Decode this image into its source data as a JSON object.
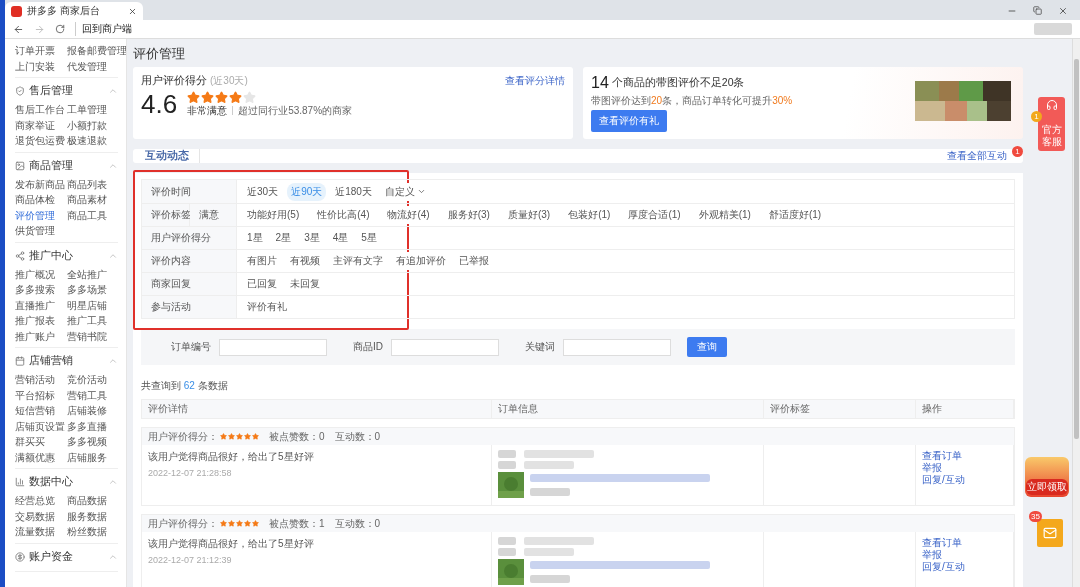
{
  "browser": {
    "tab_title": "拼多多 商家后台",
    "address": "回到商户端"
  },
  "sidebar": {
    "groups": [
      {
        "expanded": true,
        "items": [
          {
            "label": "订单开票",
            "selected": false
          },
          {
            "label": "报备邮费管理",
            "selected": false
          },
          {
            "label": "上门安装",
            "selected": false
          },
          {
            "label": "代发管理",
            "selected": false
          }
        ]
      },
      {
        "title": "售后管理",
        "expanded": true,
        "items": [
          {
            "label": "售后工作台",
            "selected": false
          },
          {
            "label": "工单管理",
            "selected": false
          },
          {
            "label": "商家举证",
            "selected": false
          },
          {
            "label": "小额打款",
            "selected": false
          },
          {
            "label": "退货包运费",
            "selected": false
          },
          {
            "label": "极速退款",
            "selected": false
          }
        ]
      },
      {
        "title": "商品管理",
        "expanded": true,
        "items": [
          {
            "label": "发布新商品",
            "selected": false
          },
          {
            "label": "商品列表",
            "selected": false
          },
          {
            "label": "商品体检",
            "selected": false
          },
          {
            "label": "商品素材",
            "selected": false
          },
          {
            "label": "评价管理",
            "selected": true
          },
          {
            "label": "商品工具",
            "selected": false
          },
          {
            "label": "供货管理",
            "selected": false
          }
        ]
      },
      {
        "title": "推广中心",
        "expanded": true,
        "items": [
          {
            "label": "推广概况",
            "selected": false
          },
          {
            "label": "全站推广",
            "selected": false
          },
          {
            "label": "多多搜索",
            "selected": false
          },
          {
            "label": "多多场景",
            "selected": false
          },
          {
            "label": "直播推广",
            "selected": false
          },
          {
            "label": "明星店铺",
            "selected": false
          },
          {
            "label": "推广报表",
            "selected": false
          },
          {
            "label": "推广工具",
            "selected": false
          },
          {
            "label": "推广账户",
            "selected": false
          },
          {
            "label": "营销书院",
            "selected": false
          }
        ]
      },
      {
        "title": "店铺营销",
        "expanded": true,
        "items": [
          {
            "label": "营销活动",
            "selected": false
          },
          {
            "label": "竞价活动",
            "selected": false
          },
          {
            "label": "平台招标",
            "selected": false
          },
          {
            "label": "营销工具",
            "selected": false
          },
          {
            "label": "短信营销",
            "selected": false
          },
          {
            "label": "店铺装修",
            "selected": false
          },
          {
            "label": "店铺页设置",
            "selected": false
          },
          {
            "label": "多多直播",
            "selected": false
          },
          {
            "label": "群买买",
            "selected": false
          },
          {
            "label": "多多视频",
            "selected": false
          },
          {
            "label": "满额优惠",
            "selected": false
          },
          {
            "label": "店铺服务",
            "selected": false
          }
        ]
      },
      {
        "title": "数据中心",
        "expanded": true,
        "items": [
          {
            "label": "经营总览",
            "selected": false
          },
          {
            "label": "商品数据",
            "selected": false
          },
          {
            "label": "交易数据",
            "selected": false
          },
          {
            "label": "服务数据",
            "selected": false
          },
          {
            "label": "流量数据",
            "selected": false
          },
          {
            "label": "粉丝数据",
            "selected": false
          }
        ]
      },
      {
        "title": "账户资金",
        "expanded": true
      }
    ]
  },
  "page_title": "评价管理",
  "score_card": {
    "title": "用户评价得分",
    "period": "(近30天)",
    "link": "查看评分详情",
    "score": "4.6",
    "stars": 4,
    "rating_text": "非常满意",
    "comparison": "超过同行业53.87%的商家"
  },
  "promo_card": {
    "count": "14",
    "headline": "个商品的带图评价不足20条",
    "subtitle": [
      {
        "text": "带图评价达到",
        "highlight": false
      },
      {
        "text": "20",
        "highlight": true
      },
      {
        "text": "条，商品订单转化可提升",
        "highlight": false
      },
      {
        "text": "30%",
        "highlight": true
      }
    ],
    "button": "查看评价有礼"
  },
  "interaction_bar": {
    "tabs": [
      {
        "label": "互动动态",
        "selected": true
      }
    ],
    "link": "查看全部互动",
    "badge": "1"
  },
  "filters": {
    "highlighted": true,
    "rows": [
      {
        "label": "评价时间",
        "options": [
          {
            "label": "近30天",
            "selected": false,
            "kind": "option"
          },
          {
            "label": "近90天",
            "selected": true,
            "kind": "option"
          },
          {
            "label": "近180天",
            "selected": false,
            "kind": "option"
          },
          {
            "label": "自定义",
            "selected": false,
            "kind": "dropdown"
          }
        ]
      },
      {
        "label": "评价标签",
        "sublabel": "满意",
        "options": [
          {
            "label": "功能好用(5)",
            "selected": false
          },
          {
            "label": "性价比高(4)",
            "selected": false
          },
          {
            "label": "物流好(4)",
            "selected": false
          },
          {
            "label": "服务好(3)",
            "selected": false
          },
          {
            "label": "质量好(3)",
            "selected": false
          },
          {
            "label": "包装好(1)",
            "selected": false
          },
          {
            "label": "厚度合适(1)",
            "selected": false
          },
          {
            "label": "外观精美(1)",
            "selected": false
          },
          {
            "label": "舒适度好(1)",
            "selected": false
          }
        ]
      },
      {
        "label": "用户评价得分",
        "options": [
          {
            "label": "1星",
            "selected": false
          },
          {
            "label": "2星",
            "selected": false
          },
          {
            "label": "3星",
            "selected": false
          },
          {
            "label": "4星",
            "selected": false
          },
          {
            "label": "5星",
            "selected": false
          }
        ]
      },
      {
        "label": "评价内容",
        "options": [
          {
            "label": "有图片",
            "selected": false
          },
          {
            "label": "有视频",
            "selected": false
          },
          {
            "label": "主评有文字",
            "selected": false
          },
          {
            "label": "有追加评价",
            "selected": false
          },
          {
            "label": "已举报",
            "selected": false
          }
        ]
      },
      {
        "label": "商家回复",
        "options": [
          {
            "label": "已回复",
            "selected": false
          },
          {
            "label": "未回复",
            "selected": false
          }
        ]
      },
      {
        "label": "参与活动",
        "options": [
          {
            "label": "评价有礼",
            "selected": false
          }
        ]
      }
    ]
  },
  "search": {
    "fields": [
      {
        "label": "订单编号"
      },
      {
        "label": "商品ID"
      },
      {
        "label": "关键词"
      }
    ],
    "button": "查询"
  },
  "result_count": {
    "prefix": "共查询到",
    "count": "62",
    "suffix": "条数据"
  },
  "table": {
    "columns": [
      "评价详情",
      "订单信息",
      "评价标签",
      "操作"
    ],
    "rows": [
      {
        "score_label": "用户评价得分：",
        "stars": 5,
        "likes": "被点赞数：0",
        "interactions": "互动数：0",
        "comment": "该用户觉得商品很好，给出了5星好评",
        "time": "2022-12-07 21:28:58",
        "actions": [
          "查看订单",
          "举报",
          "回复/互动"
        ]
      },
      {
        "score_label": "用户评价得分：",
        "stars": 5,
        "likes": "被点赞数：1",
        "interactions": "互动数：0",
        "comment": "该用户觉得商品很好，给出了5星好评",
        "time": "2022-12-07 21:12:39",
        "actions": [
          "查看订单",
          "举报",
          "回复/互动"
        ]
      }
    ]
  },
  "floating": {
    "service": {
      "label": "官方客服",
      "badge": "1"
    },
    "coupon": {
      "label": "立即领取"
    },
    "mail": {
      "badge": "35"
    }
  }
}
